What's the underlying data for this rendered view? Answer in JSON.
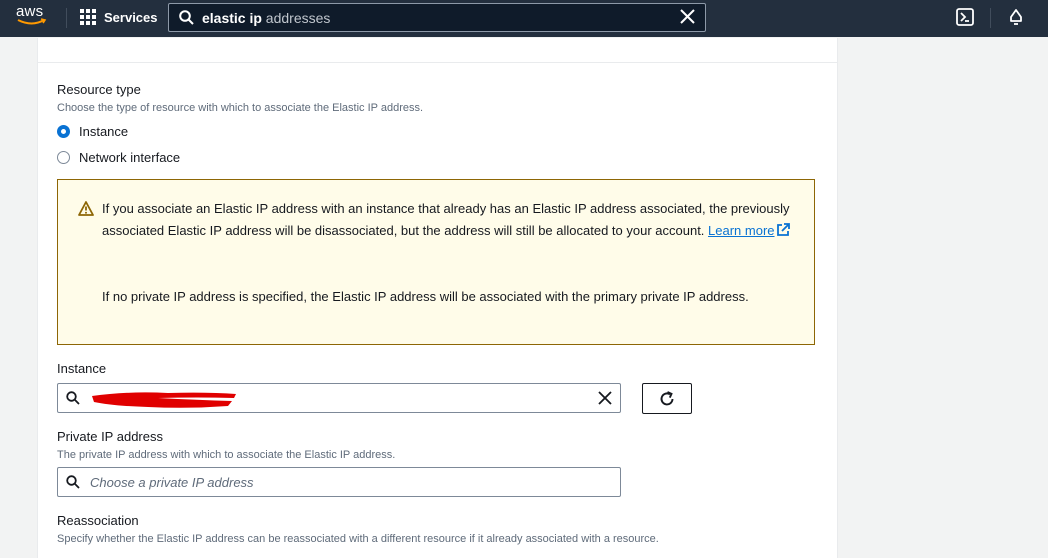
{
  "nav": {
    "logo": "aws",
    "services_label": "Services",
    "search_bold": "elastic ip",
    "search_rest": " addresses",
    "icons": [
      "grid-icon",
      "search-icon",
      "close-icon",
      "cloudshell-icon",
      "bell-icon"
    ]
  },
  "form": {
    "resource_type": {
      "label": "Resource type",
      "description": "Choose the type of resource with which to associate the Elastic IP address.",
      "options": [
        {
          "label": "Instance",
          "selected": true
        },
        {
          "label": "Network interface",
          "selected": false
        }
      ]
    },
    "alert": {
      "para1_before_link": "If you associate an Elastic IP address with an instance that already has an Elastic IP address associated, the previously associated Elastic IP address will be disassociated, but the address will still be allocated to your account. ",
      "link_text": "Learn more",
      "para2": "If no private IP address is specified, the Elastic IP address will be associated with the primary private IP address."
    },
    "instance": {
      "label": "Instance",
      "value_redacted": true
    },
    "private_ip": {
      "label": "Private IP address",
      "description": "The private IP address with which to associate the Elastic IP address.",
      "placeholder": "Choose a private IP address"
    },
    "reassociation": {
      "label": "Reassociation",
      "description": "Specify whether the Elastic IP address can be reassociated with a different resource if it already associated with a resource."
    }
  },
  "colors": {
    "nav_bg": "#232f3e",
    "accent": "#0972d3",
    "alert_bg": "#fffce9",
    "alert_border": "#8d6605",
    "redaction": "#e00000"
  }
}
